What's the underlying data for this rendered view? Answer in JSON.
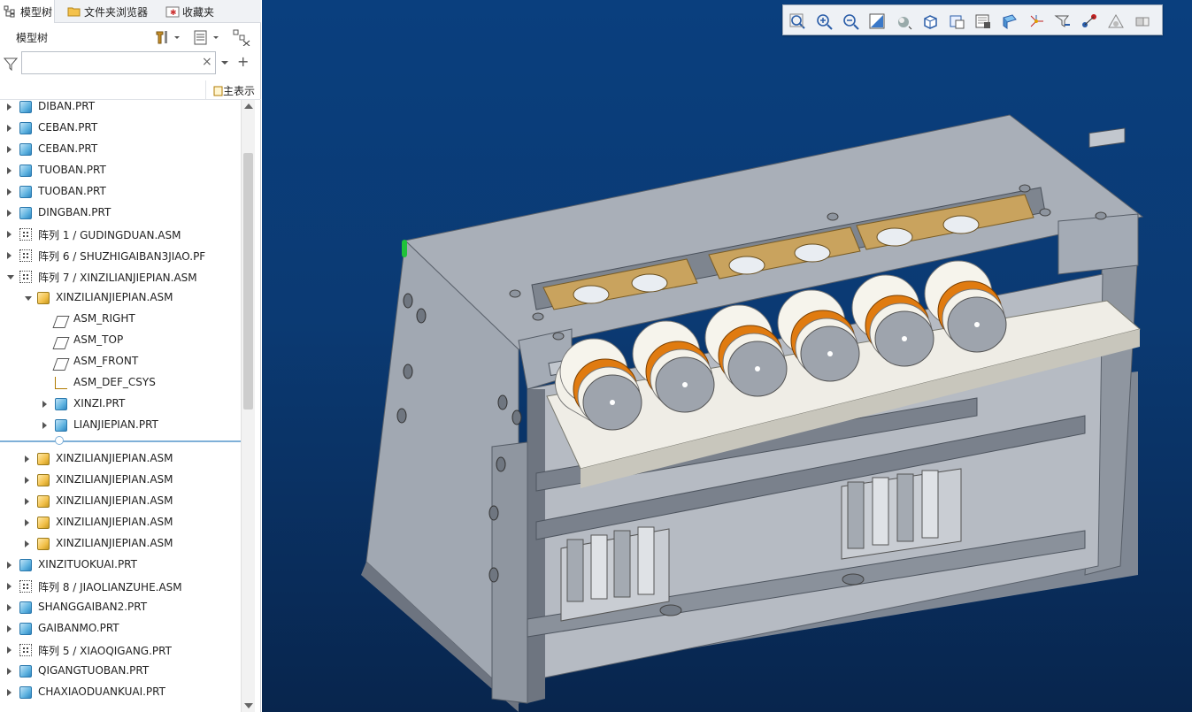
{
  "tabs": [
    {
      "label": "模型树"
    },
    {
      "label": "文件夹浏览器"
    },
    {
      "label": "收藏夹"
    }
  ],
  "header": {
    "title": "模型树"
  },
  "filter": {
    "value": "",
    "clear_symbol": "×",
    "add_symbol": "+"
  },
  "columns": {
    "main_label": "主表示"
  },
  "tree": [
    {
      "label": "DIBAN.PRT",
      "icon": "part-icon",
      "indent": 0,
      "expander": "collapsed"
    },
    {
      "label": "CEBAN.PRT",
      "icon": "part-icon",
      "indent": 0,
      "expander": "collapsed"
    },
    {
      "label": "CEBAN.PRT",
      "icon": "part-icon",
      "indent": 0,
      "expander": "collapsed"
    },
    {
      "label": "TUOBAN.PRT",
      "icon": "part-icon",
      "indent": 0,
      "expander": "collapsed"
    },
    {
      "label": "TUOBAN.PRT",
      "icon": "part-icon",
      "indent": 0,
      "expander": "collapsed"
    },
    {
      "label": "DINGBAN.PRT",
      "icon": "part-icon",
      "indent": 0,
      "expander": "collapsed"
    },
    {
      "label": "阵列 1 / GUDINGDUAN.ASM",
      "icon": "pattern-icon",
      "indent": 0,
      "expander": "collapsed"
    },
    {
      "label": "阵列 6 / SHUZHIGAIBAN3JIAO.PF",
      "icon": "pattern-icon",
      "indent": 0,
      "expander": "collapsed"
    },
    {
      "label": "阵列 7 / XINZILIANJIEPIAN.ASM",
      "icon": "pattern-icon",
      "indent": 0,
      "expander": "expanded"
    },
    {
      "label": "XINZILIANJIEPIAN.ASM",
      "icon": "assembly-icon",
      "indent": 1,
      "expander": "expanded"
    },
    {
      "label": "ASM_RIGHT",
      "icon": "datum-plane-icon",
      "indent": 2,
      "expander": "none"
    },
    {
      "label": "ASM_TOP",
      "icon": "datum-plane-icon",
      "indent": 2,
      "expander": "none"
    },
    {
      "label": "ASM_FRONT",
      "icon": "datum-plane-icon",
      "indent": 2,
      "expander": "none"
    },
    {
      "label": "ASM_DEF_CSYS",
      "icon": "csys-icon",
      "indent": 2,
      "expander": "none"
    },
    {
      "label": "XINZI.PRT",
      "icon": "part-icon",
      "indent": 2,
      "expander": "collapsed"
    },
    {
      "label": "LIANJIEPIAN.PRT",
      "icon": "part-icon",
      "indent": 2,
      "expander": "collapsed"
    },
    {
      "label": "XINZILIANJIEPIAN.ASM",
      "icon": "assembly-icon",
      "indent": 1,
      "expander": "collapsed"
    },
    {
      "label": "XINZILIANJIEPIAN.ASM",
      "icon": "assembly-icon",
      "indent": 1,
      "expander": "collapsed"
    },
    {
      "label": "XINZILIANJIEPIAN.ASM",
      "icon": "assembly-icon",
      "indent": 1,
      "expander": "collapsed"
    },
    {
      "label": "XINZILIANJIEPIAN.ASM",
      "icon": "assembly-icon",
      "indent": 1,
      "expander": "collapsed"
    },
    {
      "label": "XINZILIANJIEPIAN.ASM",
      "icon": "assembly-icon",
      "indent": 1,
      "expander": "collapsed"
    },
    {
      "label": "XINZITUOKUAI.PRT",
      "icon": "part-icon",
      "indent": 0,
      "expander": "collapsed"
    },
    {
      "label": "阵列 8 / JIAOLIANZUHE.ASM",
      "icon": "pattern-icon",
      "indent": 0,
      "expander": "collapsed"
    },
    {
      "label": "SHANGGAIBAN2.PRT",
      "icon": "part-link-icon",
      "indent": 0,
      "expander": "collapsed"
    },
    {
      "label": "GAIBANMO.PRT",
      "icon": "part-link-icon",
      "indent": 0,
      "expander": "collapsed"
    },
    {
      "label": "阵列 5 / XIAOQIGANG.PRT",
      "icon": "pattern-icon",
      "indent": 0,
      "expander": "collapsed"
    },
    {
      "label": "QIGANGTUOBAN.PRT",
      "icon": "part-icon",
      "indent": 0,
      "expander": "collapsed"
    },
    {
      "label": "CHAXIAODUANKUAI.PRT",
      "icon": "part-icon",
      "indent": 0,
      "expander": "collapsed"
    }
  ],
  "view_toolbar": [
    "refit-icon",
    "zoom-in-icon",
    "zoom-out-icon",
    "repaint-icon",
    "display-style-icon",
    "saved-orientations-icon",
    "view-manager-icon",
    "perspective-icon",
    "appearance-icon",
    "datum-display-icon",
    "annotation-display-icon",
    "spin-center-icon",
    "snapshot-icon",
    "section-icon"
  ],
  "colors": {
    "viewport_top": "#0a3f7e",
    "viewport_bottom": "#08254d",
    "part_gray": "#a9afb8",
    "copper": "#e07b10",
    "brass": "#c9a35e"
  }
}
